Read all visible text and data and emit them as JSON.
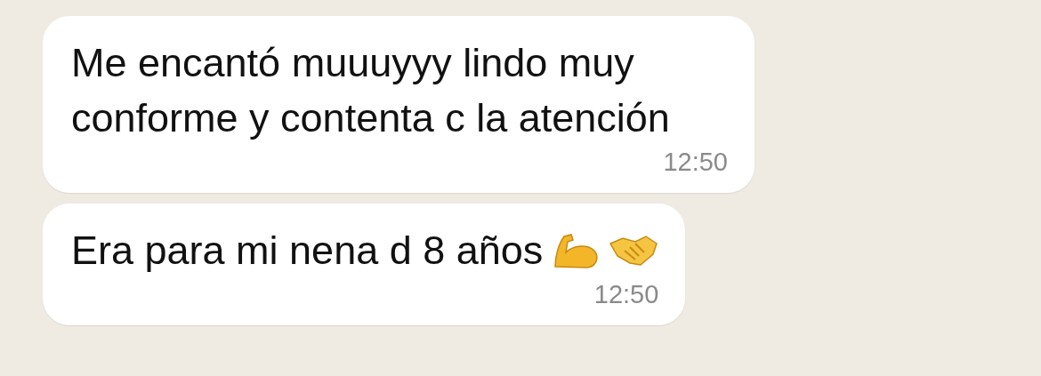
{
  "messages": [
    {
      "text": "Me encantó muuuyyy lindo muy conforme y contenta c la atención",
      "time": "12:50"
    },
    {
      "text": "Era para mi nena d 8 años",
      "time": "12:50",
      "emojis": [
        {
          "kind": "flexed-biceps"
        },
        {
          "kind": "handshake"
        }
      ]
    }
  ]
}
